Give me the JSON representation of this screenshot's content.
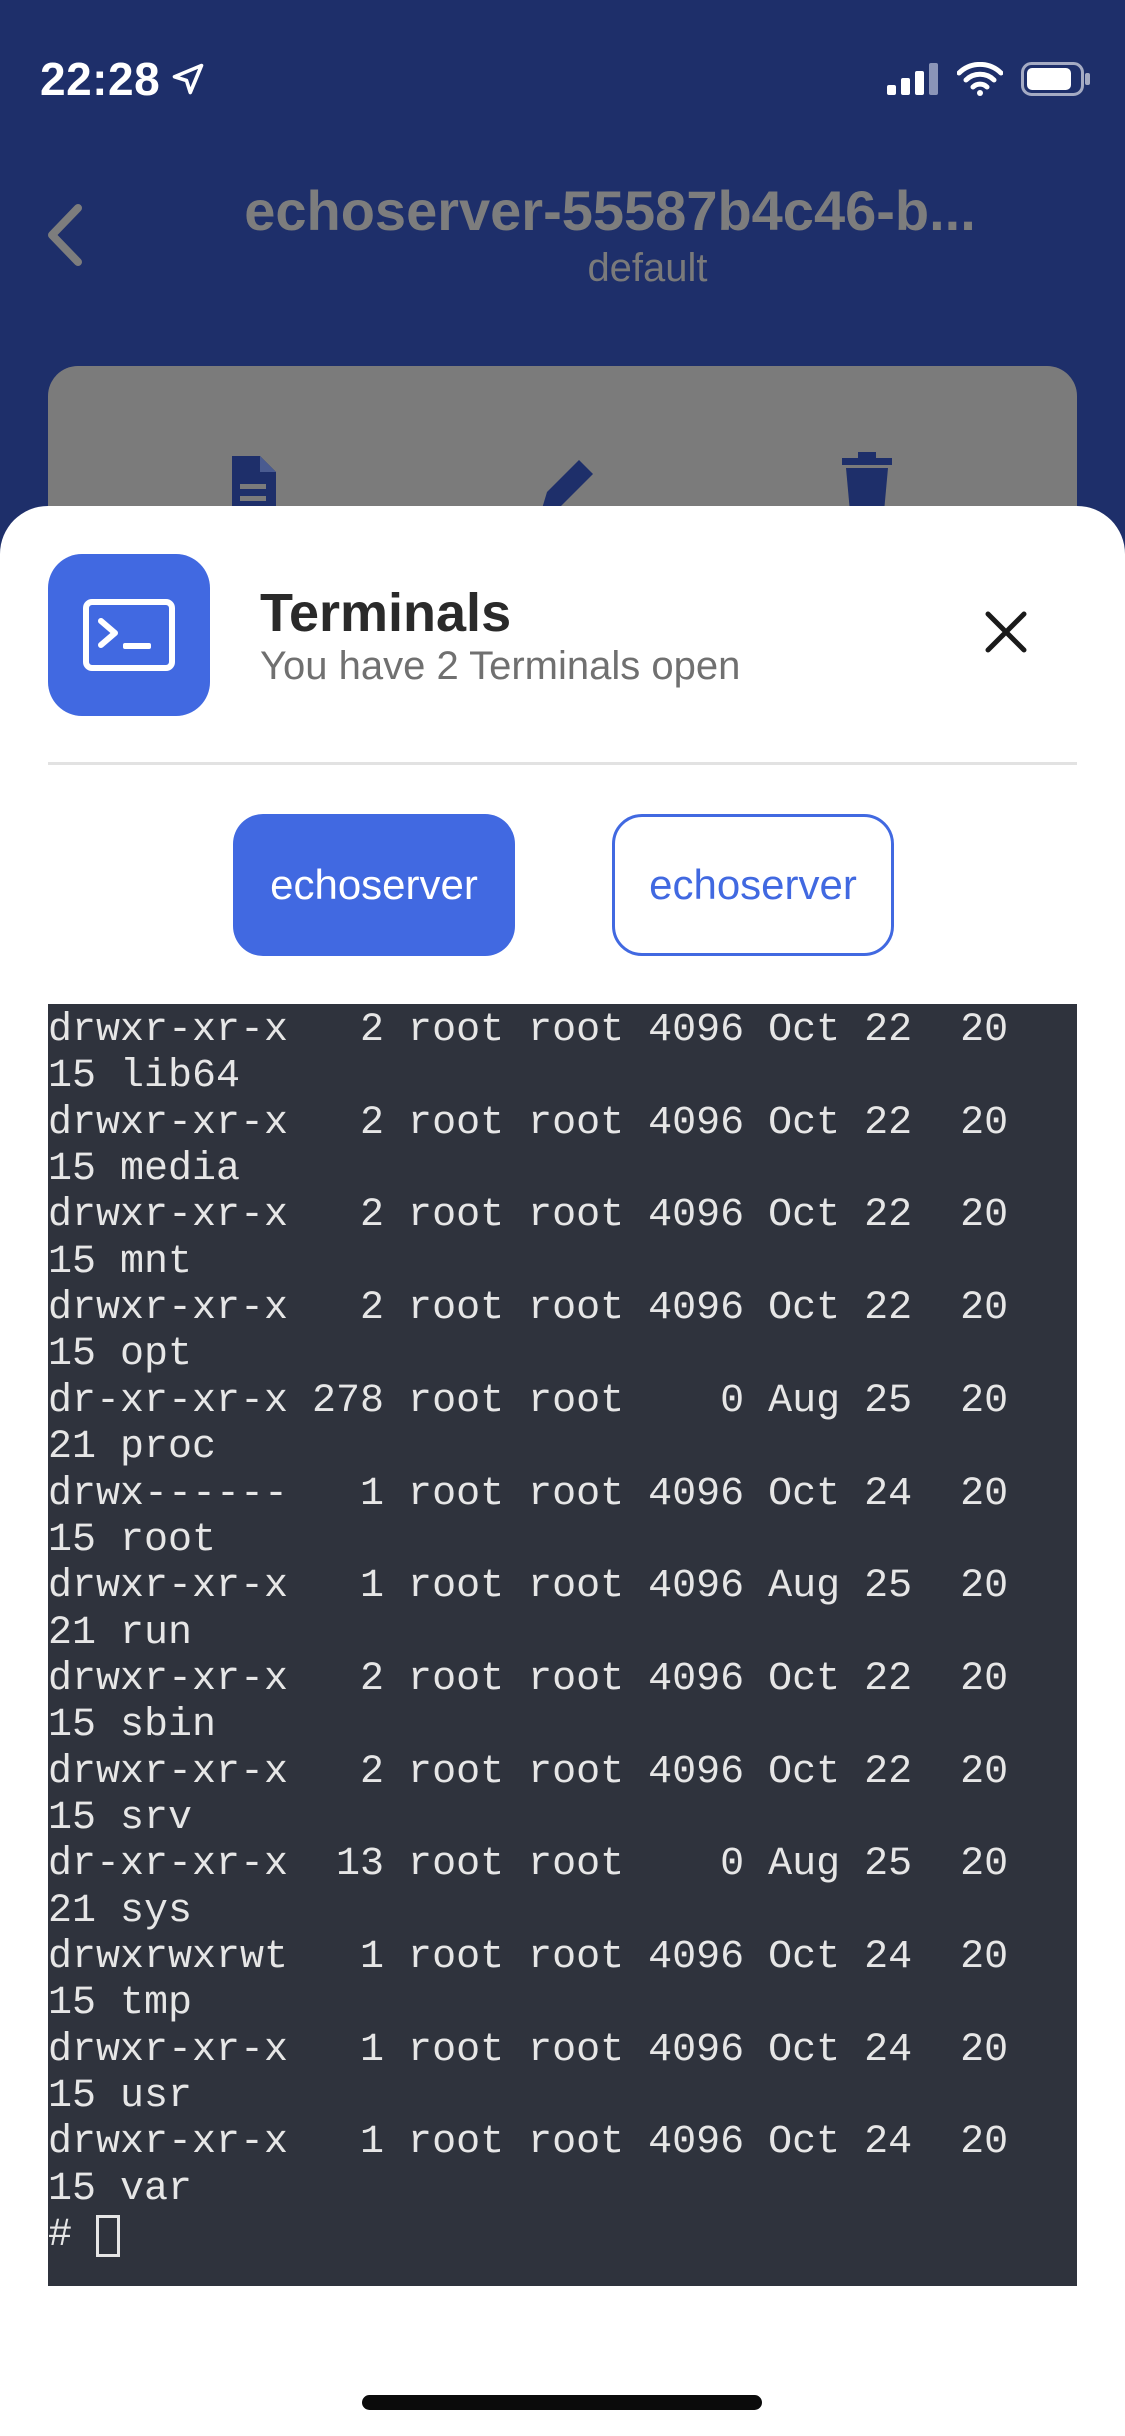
{
  "status_bar": {
    "time": "22:28",
    "icons": [
      "location-arrow-icon",
      "cellular-signal-icon",
      "wifi-icon",
      "battery-icon"
    ]
  },
  "header": {
    "title": "echoserver-55587b4c46-b...",
    "subtitle": "default",
    "back_icon": "chevron-left-icon"
  },
  "background_actions": {
    "icons": [
      "document-icon",
      "pencil-icon",
      "trash-icon"
    ]
  },
  "sheet": {
    "title": "Terminals",
    "subtitle": "You have 2 Terminals open",
    "app_icon": "terminal-icon",
    "close_icon": "close-icon",
    "tabs": [
      {
        "label": "echoserver",
        "active": true
      },
      {
        "label": "echoserver",
        "active": false
      }
    ]
  },
  "terminal": {
    "lines": [
      "drwxr-xr-x   2 root root 4096 Oct 22  20",
      "15 lib64",
      "drwxr-xr-x   2 root root 4096 Oct 22  20",
      "15 media",
      "drwxr-xr-x   2 root root 4096 Oct 22  20",
      "15 mnt",
      "drwxr-xr-x   2 root root 4096 Oct 22  20",
      "15 opt",
      "dr-xr-xr-x 278 root root    0 Aug 25  20",
      "21 proc",
      "drwx------   1 root root 4096 Oct 24  20",
      "15 root",
      "drwxr-xr-x   1 root root 4096 Aug 25  20",
      "21 run",
      "drwxr-xr-x   2 root root 4096 Oct 22  20",
      "15 sbin",
      "drwxr-xr-x   2 root root 4096 Oct 22  20",
      "15 srv",
      "dr-xr-xr-x  13 root root    0 Aug 25  20",
      "21 sys",
      "drwxrwxrwt   1 root root 4096 Oct 24  20",
      "15 tmp",
      "drwxr-xr-x   1 root root 4096 Oct 24  20",
      "15 usr",
      "drwxr-xr-x   1 root root 4096 Oct 24  20",
      "15 var"
    ],
    "prompt": "#"
  },
  "colors": {
    "header_bg": "#1e2f6a",
    "accent": "#4169e1",
    "terminal_bg": "#2f333d",
    "terminal_text": "#e6e6e6"
  }
}
